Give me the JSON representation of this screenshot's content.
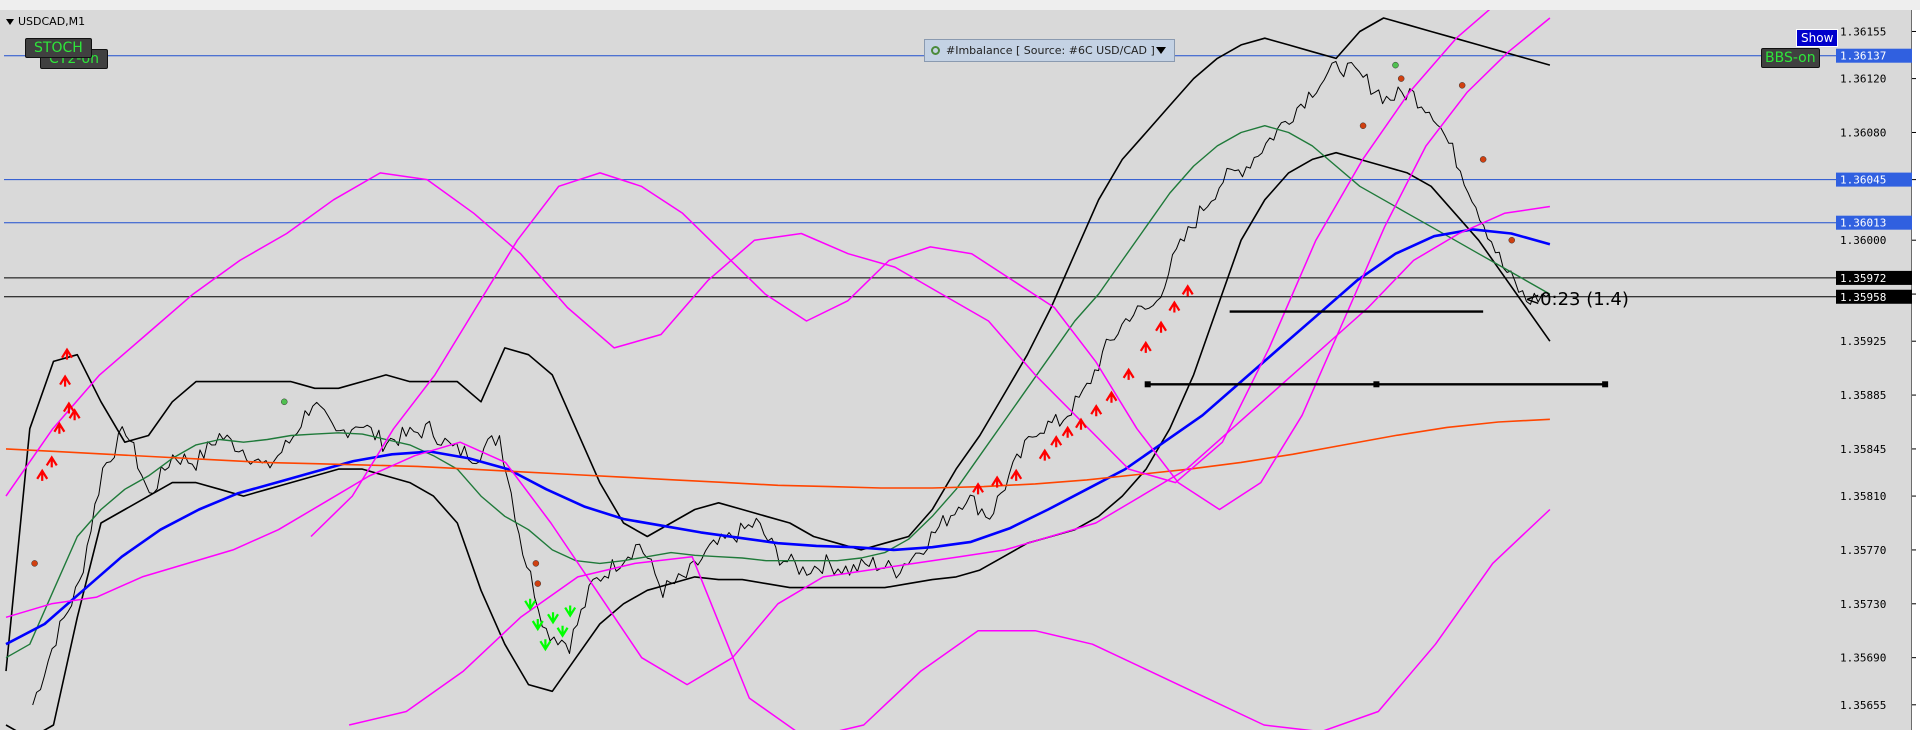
{
  "window": {
    "title": "USDCAD,M1"
  },
  "indicator_buttons": {
    "stoch": "STOCH",
    "ct2": "CT2-on",
    "bbs": "BBS-on",
    "show": "Show"
  },
  "imbalance_panel": {
    "label": "#Imbalance [ Source: #6C USD/CAD ]"
  },
  "timer_text": "<0:23 (1.4)",
  "colors": {
    "background": "#d9d9d9",
    "price": "#000000",
    "bollinger": "#000000",
    "fast_ma": "#1f7a3a",
    "ema_blue": "#0000ff",
    "envelope": "#ff00ff",
    "slow_ma": "#ff4500",
    "hline": "#2050d0",
    "bull_arrow": "#ff0000",
    "bear_arrow": "#00ff00"
  },
  "chart_data": {
    "type": "line",
    "symbol": "USDCAD",
    "timeframe": "M1",
    "ylim": [
      1.3564,
      1.36165
    ],
    "y_ticks": [
      "1.36155",
      "1.36120",
      "1.36080",
      "1.36045",
      "1.36000",
      "1.35960",
      "1.35925",
      "1.35885",
      "1.35845",
      "1.35810",
      "1.35770",
      "1.35730",
      "1.35690",
      "1.35655"
    ],
    "price_tags": [
      {
        "value": "1.36137",
        "color": "#3060e0"
      },
      {
        "value": "1.36045",
        "color": "#3060e0"
      },
      {
        "value": "1.36013",
        "color": "#3060e0"
      },
      {
        "value": "1.35972",
        "color": "#000000"
      },
      {
        "value": "1.35958",
        "color": "#000000"
      }
    ],
    "horizontal_lines": [
      1.36137,
      1.36045,
      1.36013
    ],
    "grey_lines": [
      1.35972,
      1.35958
    ],
    "levels": [
      {
        "price": 1.35947,
        "x_start": 0.642,
        "x_end": 0.775
      },
      {
        "price": 1.35893,
        "x_start": 0.599,
        "x_end": 0.839
      }
    ],
    "series": [
      {
        "key": "price",
        "values": [
          1.35655,
          1.35705,
          1.35745,
          1.3583,
          1.3586,
          1.3581,
          1.3584,
          1.35835,
          1.35855,
          1.35845,
          1.3583,
          1.3585,
          1.3588,
          1.35855,
          1.35865,
          1.3585,
          1.35855,
          1.3586,
          1.35845,
          1.3584,
          1.35855,
          1.3577,
          1.3571,
          1.357,
          1.35745,
          1.3576,
          1.35775,
          1.3574,
          1.3575,
          1.3577,
          1.3578,
          1.3579,
          1.35765,
          1.35755,
          1.3576,
          1.35755,
          1.3576,
          1.35755,
          1.3577,
          1.3579,
          1.3581,
          1.35795,
          1.3583,
          1.3586,
          1.35865,
          1.35885,
          1.3592,
          1.35945,
          1.3595,
          1.3599,
          1.3602,
          1.36045,
          1.36055,
          1.36075,
          1.36095,
          1.36115,
          1.3613,
          1.3612,
          1.36105,
          1.3611,
          1.36095,
          1.3606,
          1.3602,
          1.3598,
          1.35955,
          1.3596
        ]
      },
      {
        "key": "bb_upper",
        "values": [
          1.3568,
          1.3586,
          1.3591,
          1.35915,
          1.3588,
          1.3585,
          1.35855,
          1.3588,
          1.35895,
          1.35895,
          1.35895,
          1.35895,
          1.35895,
          1.3589,
          1.3589,
          1.35895,
          1.359,
          1.35895,
          1.35895,
          1.35895,
          1.3588,
          1.3592,
          1.35915,
          1.359,
          1.3586,
          1.3582,
          1.3579,
          1.3578,
          1.3579,
          1.358,
          1.35805,
          1.358,
          1.35795,
          1.3579,
          1.3578,
          1.35775,
          1.3577,
          1.35775,
          1.3578,
          1.358,
          1.3583,
          1.35855,
          1.35885,
          1.35915,
          1.3595,
          1.3599,
          1.3603,
          1.3606,
          1.3608,
          1.361,
          1.3612,
          1.36135,
          1.36145,
          1.3615,
          1.36145,
          1.3614,
          1.36135,
          1.36155,
          1.36165,
          1.3616,
          1.36155,
          1.3615,
          1.36145,
          1.3614,
          1.36135,
          1.3613
        ]
      },
      {
        "key": "bb_lower",
        "values": [
          1.3564,
          1.3563,
          1.3564,
          1.3572,
          1.3579,
          1.358,
          1.3581,
          1.3582,
          1.3582,
          1.35815,
          1.3581,
          1.35815,
          1.3582,
          1.35825,
          1.3583,
          1.3583,
          1.35825,
          1.3582,
          1.3581,
          1.3579,
          1.3574,
          1.357,
          1.3567,
          1.35665,
          1.3569,
          1.35715,
          1.3573,
          1.3574,
          1.35745,
          1.3575,
          1.35748,
          1.35748,
          1.35745,
          1.35742,
          1.35742,
          1.35742,
          1.35742,
          1.35742,
          1.35745,
          1.35748,
          1.3575,
          1.35755,
          1.35765,
          1.35775,
          1.3578,
          1.35785,
          1.35795,
          1.3581,
          1.3583,
          1.3586,
          1.359,
          1.3595,
          1.36,
          1.3603,
          1.3605,
          1.3606,
          1.36065,
          1.3606,
          1.36055,
          1.3605,
          1.3604,
          1.3602,
          1.36,
          1.35975,
          1.3595,
          1.35925
        ]
      },
      {
        "key": "ma_green",
        "values": [
          1.3569,
          1.357,
          1.3574,
          1.3578,
          1.358,
          1.35815,
          1.35825,
          1.35838,
          1.35848,
          1.35852,
          1.3585,
          1.35852,
          1.35855,
          1.35856,
          1.35857,
          1.35856,
          1.35852,
          1.35848,
          1.3584,
          1.3583,
          1.3581,
          1.35795,
          1.35785,
          1.3577,
          1.35762,
          1.3576,
          1.35762,
          1.35765,
          1.35768,
          1.35766,
          1.35765,
          1.35764,
          1.35762,
          1.35762,
          1.35762,
          1.35762,
          1.35764,
          1.35768,
          1.35778,
          1.35795,
          1.35815,
          1.3584,
          1.35865,
          1.3589,
          1.35915,
          1.3594,
          1.3596,
          1.35985,
          1.3601,
          1.36035,
          1.36055,
          1.3607,
          1.3608,
          1.36085,
          1.3608,
          1.3607,
          1.36055,
          1.3604,
          1.3603,
          1.3602,
          1.3601,
          1.36,
          1.3599,
          1.3598,
          1.3597,
          1.3596
        ]
      },
      {
        "key": "ema_blue",
        "values": [
          1.357,
          1.35715,
          1.3574,
          1.35765,
          1.35785,
          1.358,
          1.35812,
          1.3582,
          1.35828,
          1.35836,
          1.35841,
          1.35843,
          1.35838,
          1.3583,
          1.35815,
          1.35802,
          1.35793,
          1.35788,
          1.35783,
          1.35779,
          1.35775,
          1.35773,
          1.35772,
          1.3577,
          1.35772,
          1.35776,
          1.35786,
          1.358,
          1.35815,
          1.3583,
          1.3585,
          1.3587,
          1.35895,
          1.3592,
          1.35945,
          1.3597,
          1.3599,
          1.36003,
          1.36008,
          1.36005,
          1.35997
        ]
      },
      {
        "key": "ma_orange",
        "values": [
          1.35845,
          1.35843,
          1.35841,
          1.35839,
          1.35837,
          1.35835,
          1.35834,
          1.35833,
          1.35832,
          1.3583,
          1.35828,
          1.35826,
          1.35824,
          1.35822,
          1.3582,
          1.35818,
          1.35817,
          1.35816,
          1.35816,
          1.35817,
          1.35819,
          1.35822,
          1.35826,
          1.3583,
          1.35835,
          1.35841,
          1.35848,
          1.35855,
          1.35861,
          1.35865,
          1.35867
        ]
      },
      {
        "key": "env_upper",
        "values": [
          1.3581,
          1.3586,
          1.359,
          1.3593,
          1.3596,
          1.35985,
          1.36005,
          1.3603,
          1.3605,
          1.36045,
          1.3602,
          1.3599,
          1.3595,
          1.3592,
          1.3593,
          1.3597,
          1.36,
          1.36005,
          1.3599,
          1.3598,
          1.3596,
          1.3594,
          1.359,
          1.35865,
          1.3583,
          1.3582,
          1.3585,
          1.3592,
          1.36,
          1.3606,
          1.3611,
          1.3615,
          1.3618,
          1.36185
        ]
      },
      {
        "key": "env_lower",
        "values": [
          1.3572,
          1.3573,
          1.35735,
          1.3575,
          1.3576,
          1.3577,
          1.35785,
          1.35805,
          1.35825,
          1.3584,
          1.3585,
          1.35835,
          1.3579,
          1.3574,
          1.3569,
          1.3567,
          1.3569,
          1.3573,
          1.3575,
          1.35755,
          1.3576,
          1.35765,
          1.3577,
          1.3578,
          1.3579,
          1.3581,
          1.3583,
          1.3586,
          1.3589,
          1.3592,
          1.3595,
          1.35985,
          1.36005,
          1.3602,
          1.36025
        ]
      },
      {
        "key": "env2_upper",
        "values": [
          1.3578,
          1.3581,
          1.3586,
          1.359,
          1.3595,
          1.36,
          1.3604,
          1.3605,
          1.3604,
          1.3602,
          1.3599,
          1.3596,
          1.3594,
          1.35955,
          1.35985,
          1.35995,
          1.3599,
          1.3597,
          1.3595,
          1.3591,
          1.3586,
          1.3582,
          1.358,
          1.3582,
          1.3587,
          1.3594,
          1.3601,
          1.3607,
          1.3611,
          1.3614,
          1.36165
        ]
      },
      {
        "key": "env2_lower",
        "values": [
          1.3564,
          1.3565,
          1.3568,
          1.3572,
          1.3575,
          1.3576,
          1.35765,
          1.3566,
          1.3563,
          1.3564,
          1.3568,
          1.3571,
          1.3571,
          1.357,
          1.3568,
          1.3566,
          1.3564,
          1.35635,
          1.3565,
          1.357,
          1.3576,
          1.358
        ]
      }
    ]
  }
}
